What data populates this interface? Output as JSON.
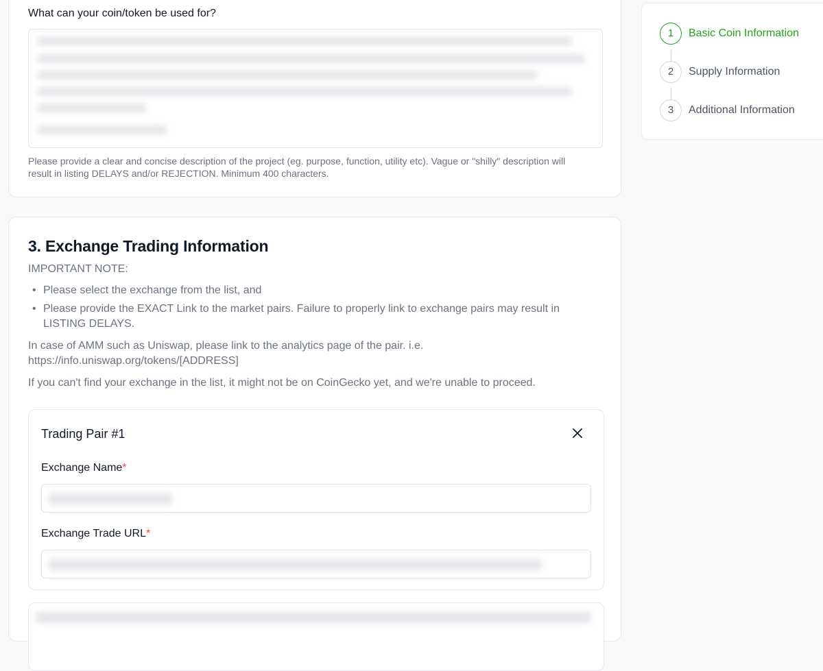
{
  "usage": {
    "question": "What can your coin/token be used for?",
    "help": "Please provide a clear and concise description of the project (eg. purpose, function, utility etc). Vague or \"shilly\" description will result in listing DELAYS and/or REJECTION. Minimum 400 characters."
  },
  "exchange": {
    "title": "3. Exchange Trading Information",
    "note_heading": "IMPORTANT NOTE:",
    "bullets": [
      "Please select the exchange from the list, and",
      "Please provide the EXACT Link to the market pairs. Failure to properly link to exchange pairs may result in LISTING DELAYS."
    ],
    "amm_note": "In case of AMM such as Uniswap, please link to the analytics page of the pair. i.e. https://info.uniswap.org/tokens/[ADDRESS]",
    "missing_note": "If you can't find your exchange in the list, it might not be on CoinGecko yet, and we're unable to proceed.",
    "pair": {
      "title": "Trading Pair #1",
      "exchange_name_label": "Exchange Name",
      "trade_url_label": "Exchange Trade URL",
      "required_mark": "*"
    }
  },
  "stepper": {
    "steps": [
      {
        "number": "1",
        "label": "Basic Coin Information",
        "active": true
      },
      {
        "number": "2",
        "label": "Supply Information",
        "active": false
      },
      {
        "number": "3",
        "label": "Additional Information",
        "active": false
      }
    ]
  },
  "colors": {
    "accent": "#22a31a",
    "required": "#ef4444",
    "muted_text": "#6b7280"
  },
  "icons": {
    "close": "close-icon"
  }
}
